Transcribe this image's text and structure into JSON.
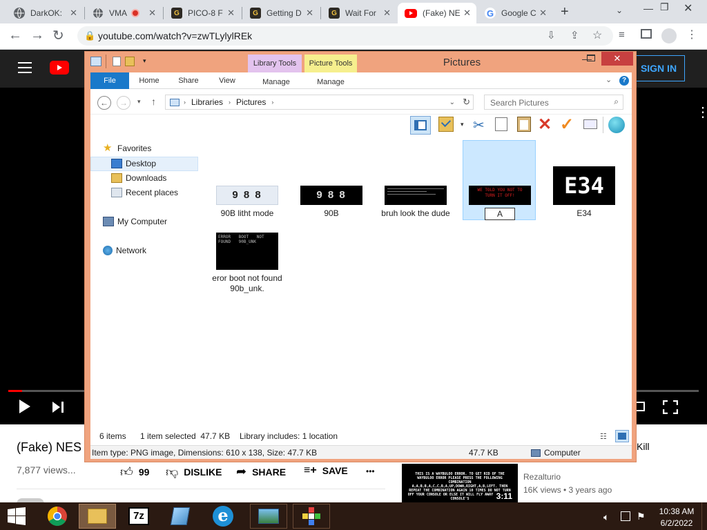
{
  "browser": {
    "tabs": [
      {
        "label": "DarkOK:",
        "icon": "globe-icon"
      },
      {
        "label": "VMA",
        "icon": "globe-icon"
      },
      {
        "label": "PICO-8 F",
        "icon": "g-logo-icon"
      },
      {
        "label": "Getting D",
        "icon": "g-logo-icon"
      },
      {
        "label": "Wait For",
        "icon": "g-logo-icon"
      },
      {
        "label": "(Fake) NE",
        "icon": "youtube-icon"
      },
      {
        "label": "Google C",
        "icon": "google-icon"
      }
    ],
    "new_tab": "+",
    "url": "youtube.com/watch?v=zwTLylylREk"
  },
  "youtube": {
    "sign_in": "SIGN IN",
    "video_title": "(Fake) NES K",
    "views": "7,877 views...",
    "likes": "99",
    "dislike": "DISLIKE",
    "share": "SHARE",
    "save": "SAVE",
    "more": "•••",
    "side_title_fragment": "Kill",
    "side_channel": "Rezalturio",
    "side_meta": "16K views • 3 years ago",
    "side_duration": "3:11",
    "side_thumb_text": "THIS IS A WAYBULOO ERROR. TO GET RID OF THE WAYBULOO ERROR PLEASE PRESS THE FOLLOWING COMBINATION A,A,B,B,A,C,C,B,A,UP,DOWN,RIGHT,A,B,LEFT. THEN REPEAT THE COMBINATION AGAIN 10 TIMES DO NOT TURN OFF YOUR CONSOLE OR ELSE IT WILL FLY AWAY WITH THE CONSOLE'S"
  },
  "explorer": {
    "title": "Pictures",
    "ribbon_tabs": [
      "File",
      "Home",
      "Share",
      "View",
      "Manage",
      "Manage"
    ],
    "contextual_tabs": [
      "Library Tools",
      "Picture Tools"
    ],
    "breadcrumb": [
      "Libraries",
      "Pictures"
    ],
    "search_placeholder": "Search Pictures",
    "nav": {
      "favorites": "Favorites",
      "desktop": "Desktop",
      "downloads": "Downloads",
      "recent": "Recent places",
      "computer": "My Computer",
      "network": "Network"
    },
    "items": [
      {
        "name": "90B litht mode",
        "thumb_text": "9 8 8"
      },
      {
        "name": "90B",
        "thumb_text": "9 8 8"
      },
      {
        "name": "bruh look the dude",
        "thumb_text": ""
      },
      {
        "name": "A",
        "thumb_text": "WE TOLD YOU NOT TO TURN IT OFF!"
      },
      {
        "name": "E34",
        "thumb_text": "E34"
      },
      {
        "name": "eror boot not found 90b_unk.",
        "thumb_text": "ERROR   BOOT NOT FOUND   90B_UNK"
      }
    ],
    "status": {
      "count": "6 items",
      "selected": "1 item selected  47.7 KB",
      "library": "Library includes: 1 location"
    },
    "details_bar": {
      "info": "Item type: PNG image, Dimensions: 610 x 138, Size: 47.7 KB",
      "size": "47.7 KB",
      "location": "Computer"
    }
  },
  "taskbar": {
    "time": "10:38 AM",
    "date": "6/2/2022",
    "zip_label": "7z"
  }
}
